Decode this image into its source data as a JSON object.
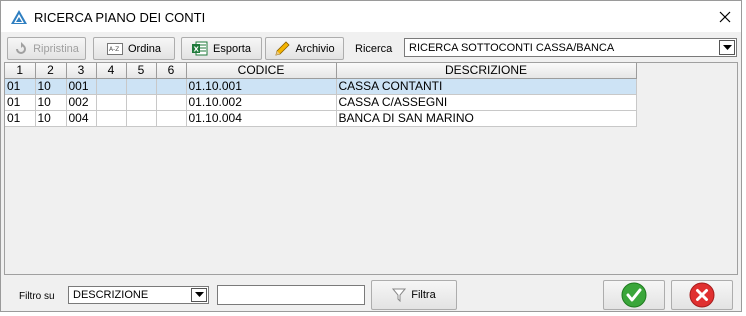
{
  "window": {
    "title": "RICERCA PIANO DEI CONTI"
  },
  "toolbar": {
    "ripristina_label": "Ripristina",
    "ordina_label": "Ordina",
    "esporta_label": "Esporta",
    "archivio_label": "Archivio",
    "search_label": "Ricerca",
    "search_value": "RICERCA SOTTOCONTI CASSA/BANCA"
  },
  "grid": {
    "columns": [
      "1",
      "2",
      "3",
      "4",
      "5",
      "6",
      "CODICE",
      "DESCRIZIONE"
    ],
    "rows": [
      [
        "01",
        "10",
        "001",
        "",
        "",
        "",
        "01.10.001",
        "CASSA CONTANTI"
      ],
      [
        "01",
        "10",
        "002",
        "",
        "",
        "",
        "01.10.002",
        "CASSA C/ASSEGNI"
      ],
      [
        "01",
        "10",
        "004",
        "",
        "",
        "",
        "01.10.004",
        "BANCA DI SAN MARINO"
      ]
    ]
  },
  "filter": {
    "label": "Filtro su",
    "field_value": "DESCRIZIONE",
    "text_value": "",
    "button_label": "Filtra"
  },
  "colors": {
    "selected_row": "#cde3f5",
    "confirm_green": "#3aa63a",
    "cancel_red": "#e03030"
  }
}
